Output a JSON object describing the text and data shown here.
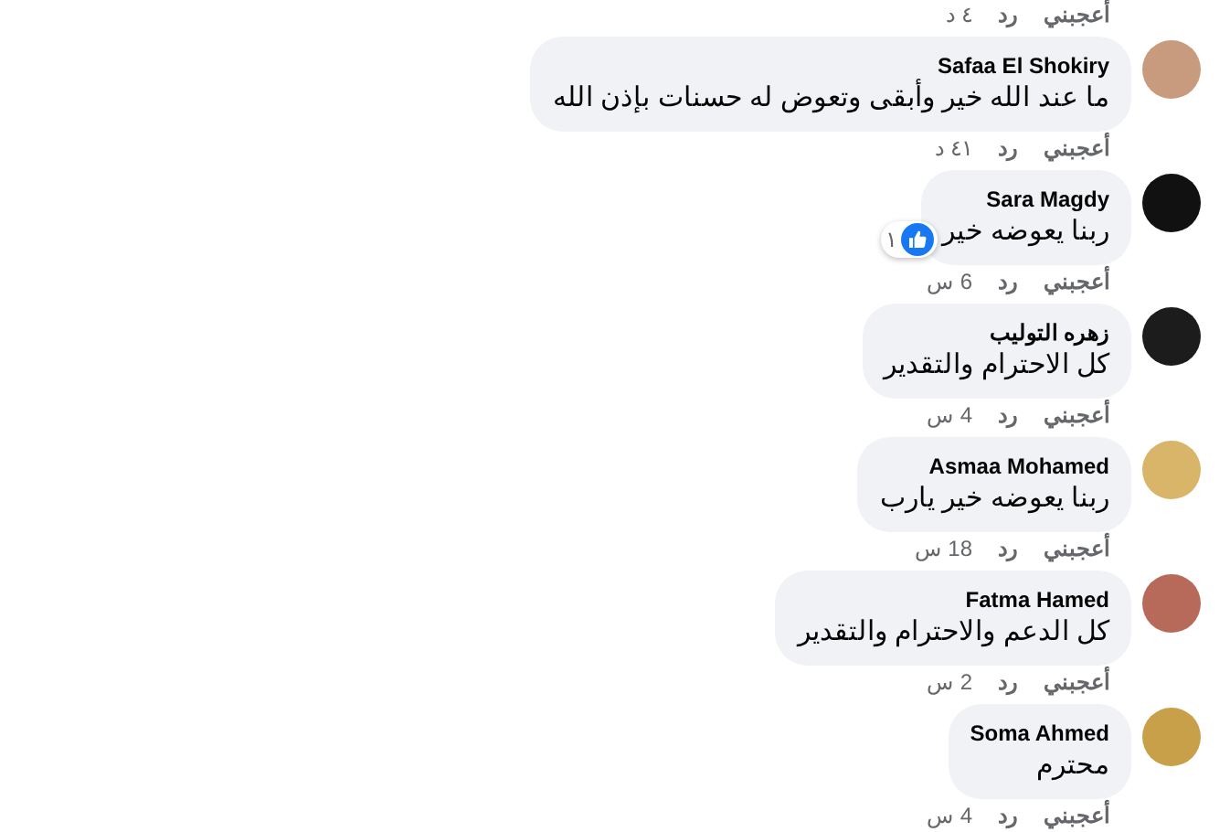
{
  "top_actions": {
    "like": "أعجبني",
    "reply": "رد",
    "time": "٤ د"
  },
  "comments": [
    {
      "color": "#c99b7e",
      "name": "Safaa El Shokiry",
      "text": "ما عند الله خير وأبقى وتعوض له حسنات بإذن الله",
      "like": "أعجبني",
      "reply": "رد",
      "time": "٤١ د"
    },
    {
      "color": "#111111",
      "name": "Sara Magdy",
      "text": "ربنا يعوضه خير",
      "reaction": {
        "count": "١"
      },
      "like": "أعجبني",
      "reply": "رد",
      "time": "6 س"
    },
    {
      "color": "#1c1c1c",
      "name": "زهره التوليب",
      "text": "كل الاحترام والتقدير",
      "like": "أعجبني",
      "reply": "رد",
      "time": "4 س"
    },
    {
      "color": "#d9b56a",
      "name": "Asmaa Mohamed",
      "text": "ربنا يعوضه خير يارب",
      "like": "أعجبني",
      "reply": "رد",
      "time": "18 س"
    },
    {
      "color": "#b86a5a",
      "name": "Fatma Hamed",
      "text": "كل الدعم والاحترام والتقدير",
      "like": "أعجبني",
      "reply": "رد",
      "time": "2 س"
    },
    {
      "color": "#c9a04a",
      "name": "Soma Ahmed",
      "text": "محترم",
      "like": "أعجبني",
      "reply": "رد",
      "time": "4 س"
    }
  ]
}
